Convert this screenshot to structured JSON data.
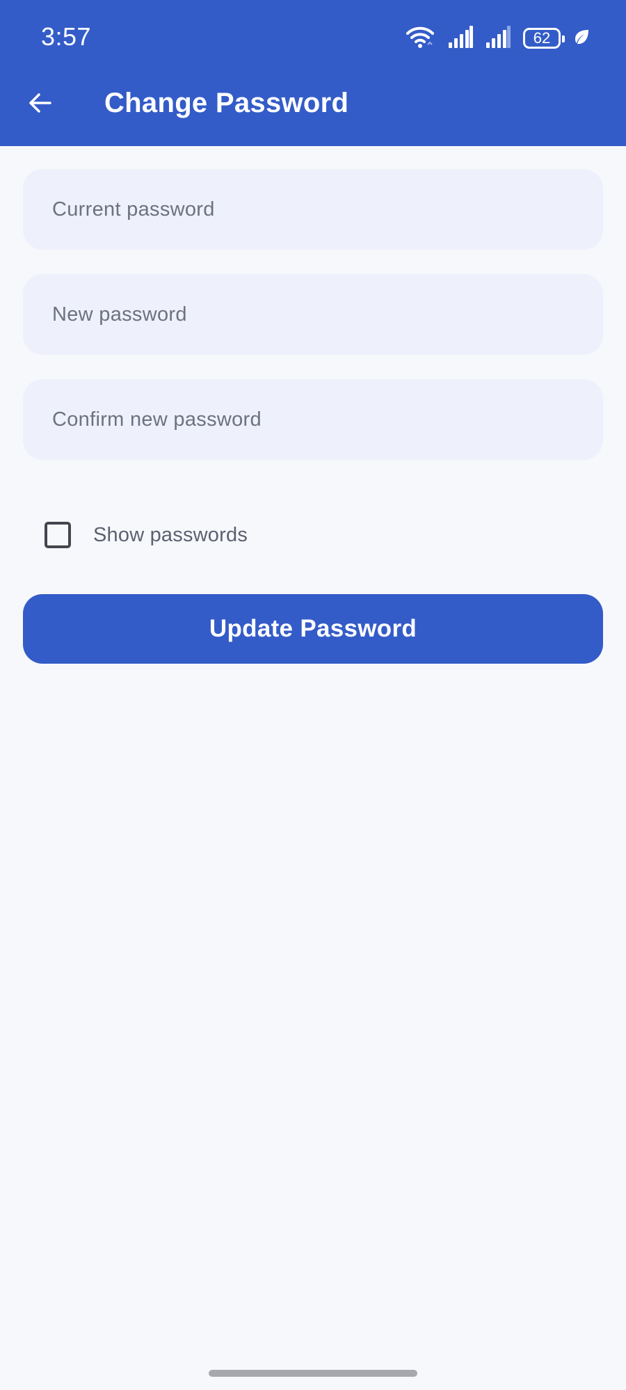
{
  "status_bar": {
    "time": "3:57",
    "battery_level": "62",
    "icons": [
      "wifi-icon",
      "signal-icon",
      "signal-icon",
      "battery-icon",
      "leaf-icon"
    ]
  },
  "app_bar": {
    "title": "Change Password",
    "back_icon": "arrow-left-icon"
  },
  "form": {
    "current_password": {
      "value": "",
      "placeholder": "Current password"
    },
    "new_password": {
      "value": "",
      "placeholder": "New password"
    },
    "confirm_password": {
      "value": "",
      "placeholder": "Confirm new password"
    },
    "show_passwords_label": "Show passwords",
    "show_passwords_checked": false,
    "submit_label": "Update Password"
  },
  "colors": {
    "primary": "#345cc8",
    "background": "#f7f8fc",
    "field_background": "#eef1fb",
    "placeholder_text": "#6d7180"
  }
}
